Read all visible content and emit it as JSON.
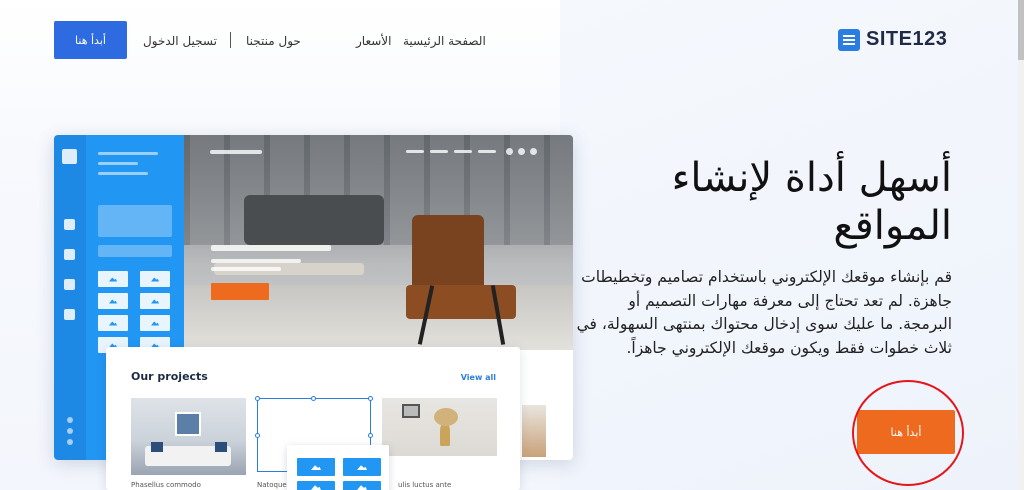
{
  "header": {
    "logo_text": "SITE123",
    "nav": {
      "home": "الصفحة الرئيسية",
      "pricing": "الأسعار",
      "about_product": "حول منتجنا",
      "separator": "|",
      "login": "تسجيل الدخول"
    },
    "cta_label": "أبدأ هنا"
  },
  "hero": {
    "title": "أسهل أداة لإنشاء المواقع",
    "description": "قم بإنشاء موقعك الإلكتروني باستخدام تصاميم وتخطيطات جاهزة. لم تعد تحتاج إلى معرفة مهارات التصميم أو البرمجة. ما عليك سوى إدخال محتواك بمنتهى السهولة، في ثلاث خطوات فقط ويكون موقعك الإلكتروني جاهزاً.",
    "cta_label": "أبدأ هنا"
  },
  "mockup": {
    "projects_title": "Our projects",
    "view_all": "View all",
    "captions": [
      "Phasellus commodo",
      "Natoque",
      "ulis luctus ante"
    ]
  },
  "colors": {
    "brand_blue": "#2f6be0",
    "cta_orange": "#ee6a1f",
    "highlight_red": "#e5161b",
    "sidebar_blue": "#2196f3"
  }
}
